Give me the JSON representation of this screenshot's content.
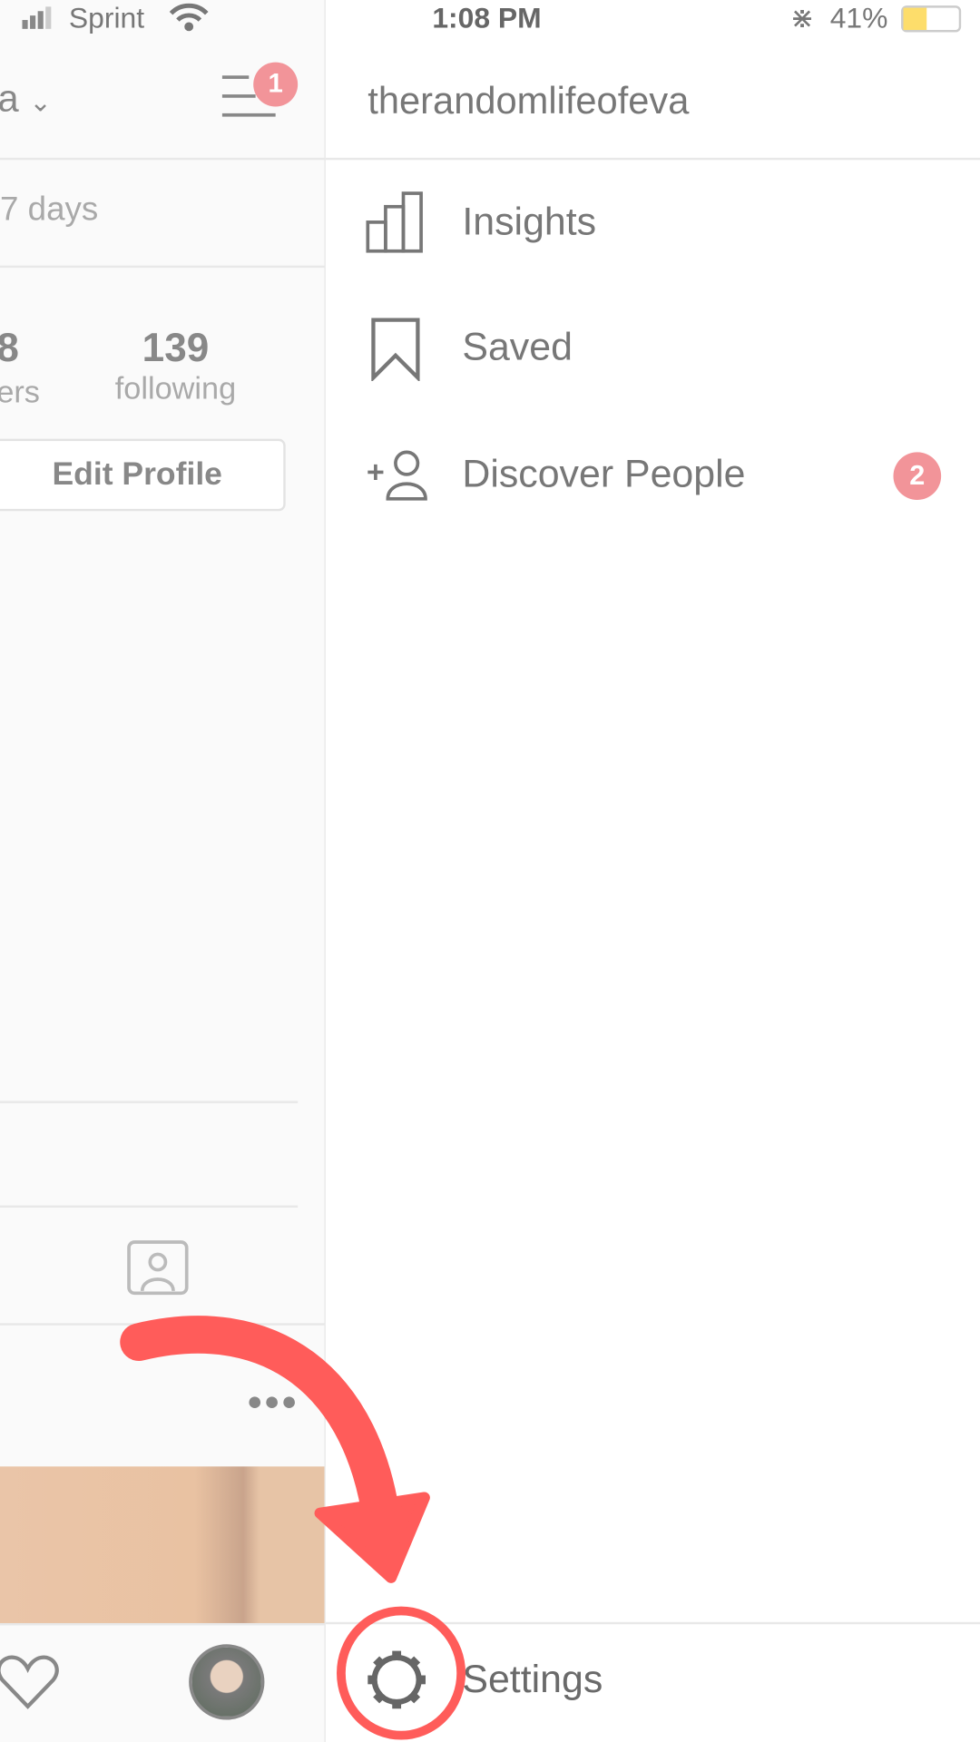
{
  "status_bar": {
    "carrier": "Sprint",
    "time": "1:08 PM",
    "battery": "41%",
    "battery_level": 0.41,
    "icons": [
      "signal-icon",
      "wifi-icon",
      "bluetooth-icon",
      "battery-icon"
    ]
  },
  "profile": {
    "username_fragment": "a",
    "notification_count": "1",
    "period_text": "7 days",
    "followers_count_fragment": "8",
    "followers_label_fragment": "ers",
    "following_count": "139",
    "following_label": "following",
    "edit_profile_label": "Edit Profile"
  },
  "drawer": {
    "username": "therandomlifeofeva",
    "items": [
      {
        "label": "Insights",
        "icon": "bar-chart-icon"
      },
      {
        "label": "Saved",
        "icon": "bookmark-icon"
      },
      {
        "label": "Discover People",
        "icon": "add-person-icon",
        "badge": "2"
      }
    ],
    "settings_label": "Settings"
  },
  "colors": {
    "annotation": "#ff5c5a",
    "badge": "#f29499"
  }
}
